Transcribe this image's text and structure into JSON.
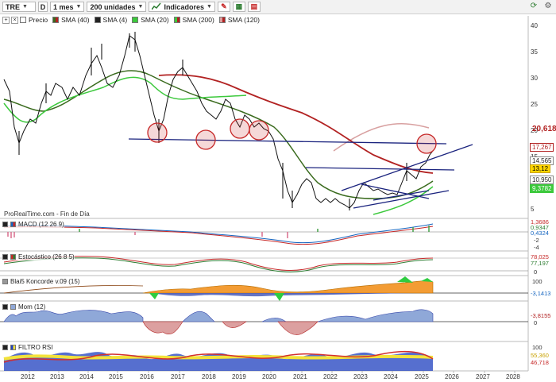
{
  "toolbar": {
    "symbol": "TRE",
    "d_button": "D",
    "timeframe": "1 mes",
    "units": "200 unidades",
    "indicators": "Indicadores"
  },
  "legend": {
    "price": "Precio",
    "sma1": "SMA (40)",
    "sma2": "SMA (4)",
    "sma3": "SMA (20)",
    "sma4": "SMA (200)",
    "sma5": "SMA (120)"
  },
  "source_text": "ProRealTime.com - Fin de Día",
  "price_axis": [
    "40",
    "35",
    "30",
    "25",
    "20",
    "15",
    "10",
    "5"
  ],
  "price_tags": {
    "sma200": "20,618",
    "circle": "17,267",
    "channel": "14,565",
    "last": "13,12",
    "sma20": "10,950",
    "sma40": "9,3782"
  },
  "panels": {
    "macd": {
      "label": "MACD (12 26 9)",
      "axis": [
        "1,3686",
        "0,9347",
        "0,4324",
        "-2",
        "-4"
      ]
    },
    "stoch": {
      "label": "Estocástico (26 8 5)",
      "axis": [
        "78,025",
        "77,197",
        "0"
      ]
    },
    "blai": {
      "label": "Blai5 Koncorde v.09 (15)",
      "axis": [
        "100",
        "-3,1413"
      ]
    },
    "mom": {
      "label": "Mom (12)",
      "axis": [
        "-3,8155",
        "0"
      ]
    },
    "rsi": {
      "label": "FILTRO RSI",
      "axis": [
        "100",
        "55,360",
        "46,718"
      ]
    }
  },
  "x_axis": [
    "2012",
    "2013",
    "2014",
    "2015",
    "2016",
    "2017",
    "2018",
    "2019",
    "2020",
    "2021",
    "2022",
    "2023",
    "2024",
    "2025",
    "2026",
    "2027",
    "2028"
  ],
  "colors": {
    "sma200": "#b22222",
    "sma120": "#d8a0a0",
    "sma40": "#3a6b1e",
    "sma20": "#3cc93c",
    "line": "#1a237e",
    "circle": "#c62828"
  }
}
